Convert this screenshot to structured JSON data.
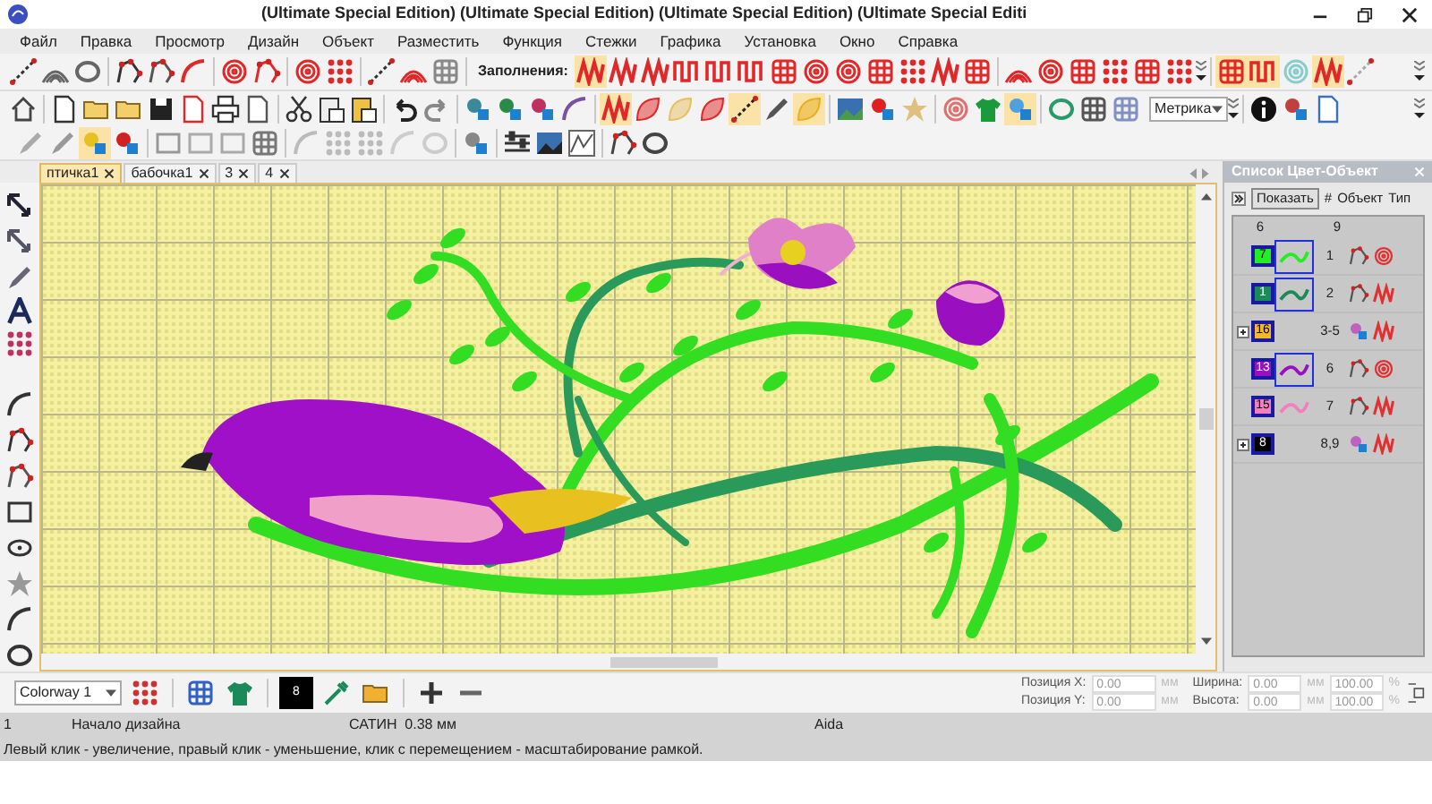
{
  "window": {
    "title": "(Ultimate Special Edition) (Ultimate Special Edition) (Ultimate Special Edition) (Ultimate Special Editi"
  },
  "menu": [
    "Файл",
    "Правка",
    "Просмотр",
    "Дизайн",
    "Объект",
    "Разместить",
    "Функция",
    "Стежки",
    "Графика",
    "Установка",
    "Окно",
    "Справка"
  ],
  "toolbar": {
    "fills_label": "Заполнения:",
    "units": "Метрика"
  },
  "tabs": [
    {
      "label": "птичка1",
      "selected": true
    },
    {
      "label": "бабочка1",
      "selected": false
    },
    {
      "label": "3",
      "selected": false
    },
    {
      "label": "4",
      "selected": false
    }
  ],
  "panel": {
    "title": "Список Цвет-Объект",
    "show_button": "Показать",
    "columns": [
      "#",
      "Объект",
      "Тип"
    ],
    "counts": [
      "6",
      "9"
    ],
    "rows": [
      {
        "label": "7",
        "color": "#22ee22",
        "objects": "1",
        "kind": "fill",
        "selected": true
      },
      {
        "label": "1",
        "color": "#1a8a5a",
        "objects": "2",
        "kind": "satin",
        "selected": true
      },
      {
        "label": "16",
        "color": "#f5b82a",
        "objects": "3-5",
        "kind": "group",
        "selected": false
      },
      {
        "label": "13",
        "color": "#9a10c0",
        "objects": "6",
        "kind": "fill",
        "selected": true
      },
      {
        "label": "15",
        "color": "#f27fbf",
        "objects": "7",
        "kind": "satin",
        "selected": false
      },
      {
        "label": "8",
        "color": "#000000",
        "objects": "8,9",
        "kind": "group",
        "selected": false
      }
    ]
  },
  "bottom": {
    "colorway": "Colorway 1",
    "current_color": "8",
    "fields": [
      {
        "label": "Позиция X:",
        "value": "0.00",
        "unit": "мм"
      },
      {
        "label": "Позиция Y:",
        "value": "0.00",
        "unit": "мм"
      },
      {
        "label": "Ширина:",
        "value": "0.00",
        "unit": "мм",
        "percent": "100.00",
        "percent_unit": "%"
      },
      {
        "label": "Высота:",
        "value": "0.00",
        "unit": "мм",
        "percent": "100.00",
        "percent_unit": "%"
      }
    ]
  },
  "status_bar": {
    "cells": [
      "1",
      "Начало дизайна",
      "САТИН  0.38 мм",
      "Aida"
    ],
    "hint": "Левый клик - увеличение, правый клик - уменьшение, клик с перемещением - масштабирование рамкой."
  }
}
